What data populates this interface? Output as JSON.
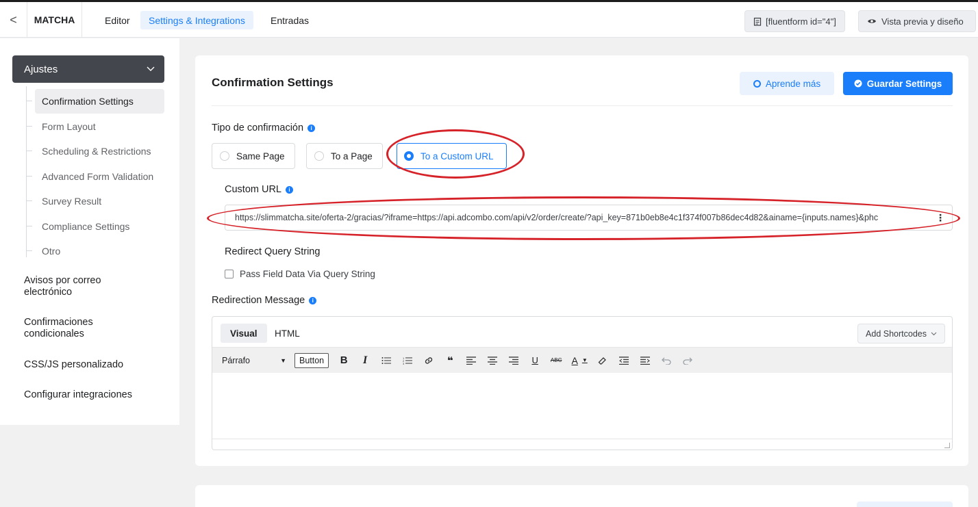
{
  "topbar": {
    "back_glyph": "<",
    "brand": "MATCHA",
    "nav": [
      {
        "label": "Editor"
      },
      {
        "label": "Settings & Integrations"
      },
      {
        "label": "Entradas"
      }
    ],
    "shortcode": "[fluentform id=\"4\"]",
    "preview": "Vista previa y diseño"
  },
  "sidebar": {
    "ajustes": "Ajustes",
    "items": [
      {
        "label": "Confirmation Settings"
      },
      {
        "label": "Form Layout"
      },
      {
        "label": "Scheduling & Restrictions"
      },
      {
        "label": "Advanced Form Validation"
      },
      {
        "label": "Survey Result"
      },
      {
        "label": "Compliance Settings"
      },
      {
        "label": "Otro"
      }
    ],
    "links": [
      {
        "label": "Avisos por correo electrónico"
      },
      {
        "label": "Confirmaciones condicionales"
      },
      {
        "label": "CSS/JS personalizado"
      },
      {
        "label": "Configurar integraciones"
      }
    ]
  },
  "main": {
    "title": "Confirmation Settings",
    "learn_more": "Aprende más",
    "save": "Guardar Settings",
    "confirmation_type_label": "Tipo de confirmación",
    "options": [
      {
        "label": "Same Page",
        "checked": false
      },
      {
        "label": "To a Page",
        "checked": false
      },
      {
        "label": "To a Custom URL",
        "checked": true
      }
    ],
    "custom_url_label": "Custom URL",
    "custom_url_value": "https://slimmatcha.site/oferta-2/gracias/?iframe=https://api.adcombo.com/api/v2/order/create/?api_key=871b0eb8e4c1f374f007b86dec4d82&ainame={inputs.names}&phc",
    "redirect_query_label": "Redirect Query String",
    "pass_field_data": "Pass Field Data Via Query String",
    "redirection_message_label": "Redirection Message",
    "editor": {
      "tab_visual": "Visual",
      "tab_html": "HTML",
      "add_shortcodes": "Add Shortcodes",
      "format_select": "Párrafo",
      "button_label": "Button"
    }
  },
  "colors": {
    "accent": "#1a7efb",
    "sidebar_active_bg": "#43464d",
    "annotation": "#d6232a"
  }
}
